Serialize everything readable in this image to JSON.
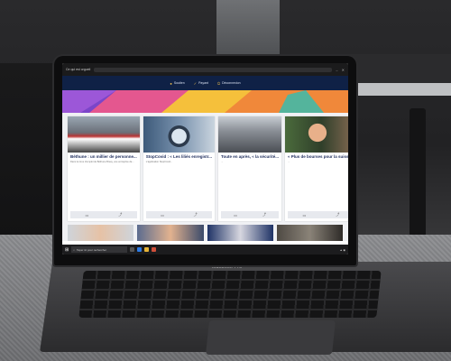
{
  "browser": {
    "tab_title": "Ce qui est orgueil",
    "minimize_icon": "minimize-icon",
    "close_icon": "close-icon"
  },
  "site_nav": {
    "items": [
      {
        "icon": "person-icon",
        "label": "Soutien"
      },
      {
        "icon": "check-icon",
        "label": "Payant"
      },
      {
        "icon": "logout-icon",
        "label": "Déconnexion"
      }
    ]
  },
  "cards": [
    {
      "title": "Béthune : un millier de personne...",
      "text": "Dans la zone d'emploi de Béthune Bruay, une entreprise de...",
      "image": "protest-crowd-with-banner"
    },
    {
      "title": "StopCovid : « Les liliés enregistr...",
      "text": "L'application StopCovid...",
      "image": "hand-holding-phone"
    },
    {
      "title": "Toute en après, « la sécurité...",
      "text": "...",
      "image": "city-street-crowd"
    },
    {
      "title": "« Plus de bourses pour la suisse »",
      "text": "...",
      "image": "person-portrait"
    }
  ],
  "card_actions": {
    "chat_icon": "comment-icon",
    "share_icon": "share-icon"
  },
  "taskbar": {
    "search_placeholder": "Taper ici pour rechercher",
    "start_icon": "windows-start-icon"
  },
  "laptop": {
    "model_label": "MacBook Pro"
  },
  "colors": {
    "nav_bg": "#0f2146",
    "banner_purple": "#7b45c9",
    "banner_orange": "#f0883a",
    "banner_yellow": "#f5c03b",
    "banner_pink": "#e4578f"
  }
}
